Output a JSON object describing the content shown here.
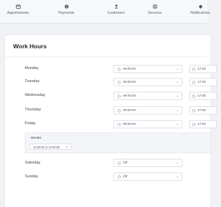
{
  "nav": {
    "items": [
      {
        "label": "Appointments",
        "icon": "calendar-icon"
      },
      {
        "label": "Payments",
        "icon": "payment-icon"
      },
      {
        "label": "Customers",
        "icon": "customers-icon"
      },
      {
        "label": "Services",
        "icon": "services-icon"
      },
      {
        "label": "Notifications",
        "icon": "bell-icon"
      }
    ]
  },
  "page": {
    "title": "Work Hours"
  },
  "days": [
    {
      "label": "Monday",
      "start": "09:00:00",
      "end": "17:00"
    },
    {
      "label": "Tuesday",
      "start": "09:00:00",
      "end": "17:00"
    },
    {
      "label": "Wednesday",
      "start": "09:00:00",
      "end": "17:00"
    },
    {
      "label": "Thursday",
      "start": "09:00:00",
      "end": "17:00"
    },
    {
      "label": "Friday",
      "start": "09:00:00",
      "end": "17:00"
    },
    {
      "label": "Saturday",
      "start": "Off"
    },
    {
      "label": "Sunday",
      "start": "Off"
    }
  ],
  "breaks": {
    "title": "Breaks",
    "chip": "10:00:00 to 10:00:00",
    "remove": "×"
  },
  "colors": {
    "background": "#f1f2f6",
    "card": "#ffffff",
    "border": "#dcdfe6"
  }
}
